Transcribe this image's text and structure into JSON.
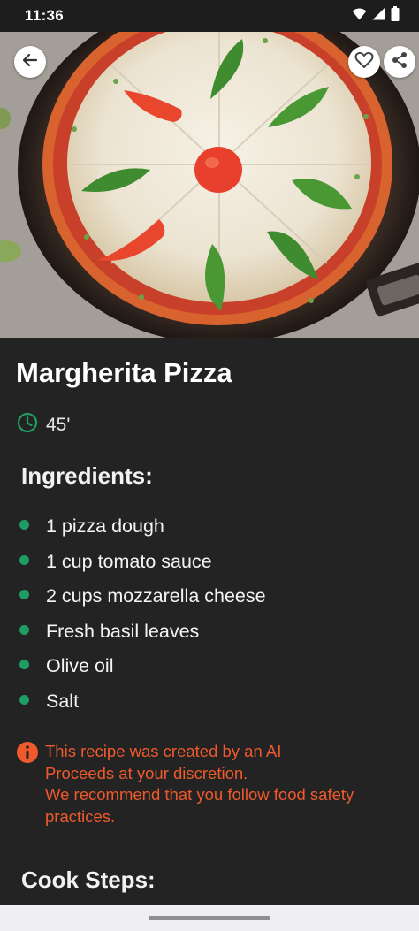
{
  "status_bar": {
    "time": "11:36",
    "icons": [
      "wifi-icon",
      "signal-icon",
      "battery-icon"
    ]
  },
  "hero": {
    "image": "pizza-photo",
    "buttons": [
      "back-arrow-icon",
      "heart-icon",
      "share-icon"
    ]
  },
  "recipe": {
    "title": "Margherita Pizza",
    "cook_time": "45'",
    "ingredients_heading": "Ingredients:",
    "ingredients": [
      "1 pizza dough",
      "1 cup tomato sauce",
      "2 cups mozzarella cheese",
      "Fresh basil leaves",
      "Olive oil",
      "Salt"
    ],
    "ai_notice": [
      "This recipe was created by an AI",
      "Proceeds at your discretion.",
      "We recommend that you follow food safety",
      "practices."
    ],
    "steps_heading": "Cook Steps:"
  },
  "colors": {
    "accent": "#1f9e63",
    "warning": "#ee5a2c",
    "background": "#232323"
  }
}
